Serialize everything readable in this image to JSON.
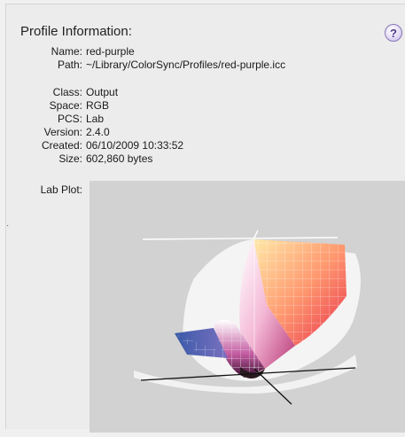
{
  "profile": {
    "title": "Profile Information:",
    "fields": [
      {
        "label": "Name:",
        "value": "red-purple"
      },
      {
        "label": "Path:",
        "value": "~/Library/ColorSync/Profiles/red-purple.icc"
      },
      {
        "label": "Class:",
        "value": "Output"
      },
      {
        "label": "Space:",
        "value": "RGB"
      },
      {
        "label": "PCS:",
        "value": "Lab"
      },
      {
        "label": "Version:",
        "value": "2.4.0"
      },
      {
        "label": "Created:",
        "value": "06/10/2009 10:33:52"
      },
      {
        "label": "Size:",
        "value": "602,860 bytes"
      }
    ],
    "lab_plot_label": "Lab Plot:"
  },
  "icons": {
    "help": "help-icon",
    "plot_toggle": "disclosure-triangle-icon"
  },
  "help_glyph": "?",
  "colors": {
    "panel_bg": "#ececec",
    "plot_bg": "#d2d2d2",
    "help_accent": "#4a3a8a"
  }
}
